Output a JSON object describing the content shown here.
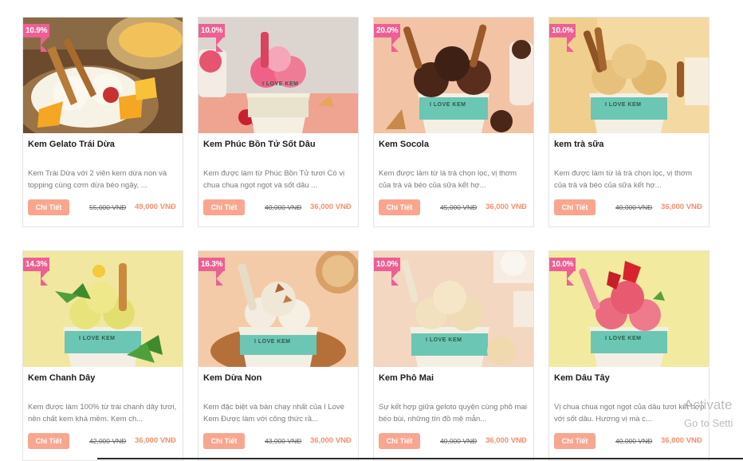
{
  "colors": {
    "badge": "#ee5f93",
    "button": "#f8a68f",
    "price": "#f58f6e"
  },
  "detail_label": "Chi Tiết",
  "products": [
    {
      "discount": "10.9%",
      "name": "Kem Gelato Trái Dừa",
      "description": "Kem Trái Dừa với 2 viên kem dừa non và topping cùng cơm dừa béo ngậy, ...",
      "old_price": "55,000 VNĐ",
      "new_price": "49,000 VNĐ"
    },
    {
      "discount": "10.0%",
      "name": "Kem Phúc Bồn Tử Sốt Dâu",
      "description": "Kem được làm từ Phúc Bồn Tử tươi Có vị chua chua ngọt ngọt và sốt dâu ...",
      "old_price": "40,000 VNĐ",
      "new_price": "36,000 VNĐ"
    },
    {
      "discount": "20.0%",
      "name": "Kem Socola",
      "description": "Kem được làm từ lá trà chọn lọc, vị thơm của trà và béo của sữa kết hợ...",
      "old_price": "45,000 VNĐ",
      "new_price": "36,000 VNĐ"
    },
    {
      "discount": "10.0%",
      "name": "kem trà sữa",
      "description": "Kem được làm từ lá trà chọn lọc, vị thơm của trà và béo của sữa kết hợ...",
      "old_price": "40,000 VNĐ",
      "new_price": "36,000 VNĐ"
    },
    {
      "discount": "14.3%",
      "name": "Kem Chanh Dây",
      "description": "Kem được làm 100% từ trái chanh dây tươi, nên chất kem khá mềm. Kem ch...",
      "old_price": "42,000 VNĐ",
      "new_price": "36,000 VNĐ"
    },
    {
      "discount": "16.3%",
      "name": "Kem Dừa Non",
      "description": "Kem đặc biệt và bán chạy nhất của I Love Kem Được làm với công thức rầ...",
      "old_price": "43,000 VNĐ",
      "new_price": "36,000 VNĐ"
    },
    {
      "discount": "10.0%",
      "name": "Kem Phô Mai",
      "description": "Sự kết hợp giữa geloto quyện cùng phô mai béo bùi, những tín đồ mê mẫn...",
      "old_price": "40,000 VNĐ",
      "new_price": "36,000 VNĐ"
    },
    {
      "discount": "10.0%",
      "name": "Kem Dâu Tây",
      "description": "Vị chua chua ngọt ngọt của dâu tươi kết hợp với sốt dâu. Hương vị mà c...",
      "old_price": "40,000 VNĐ",
      "new_price": "36,000 VNĐ"
    }
  ],
  "watermark": {
    "title": "Activate",
    "subtitle": "Go to Setti"
  }
}
